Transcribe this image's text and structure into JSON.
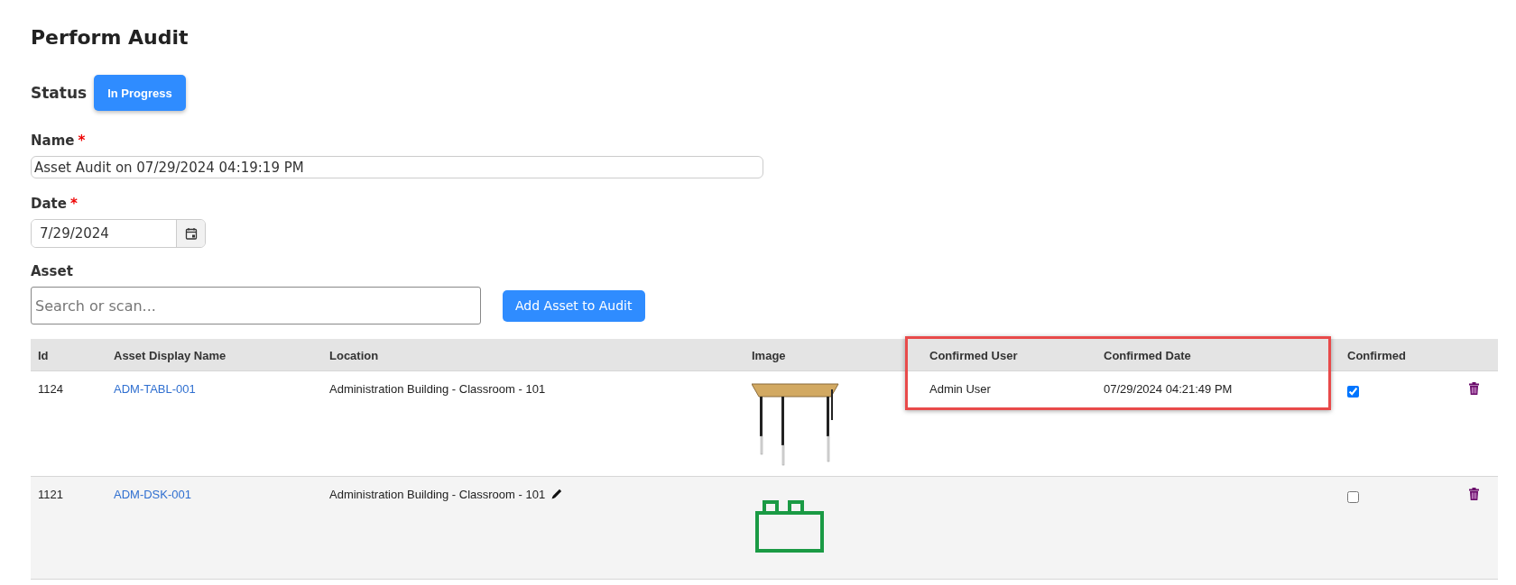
{
  "page": {
    "title": "Perform Audit"
  },
  "status": {
    "label": "Status",
    "value": "In Progress"
  },
  "fields": [
    {
      "label": "Name",
      "required_mark": "*",
      "value": "Asset Audit on 07/29/2024 04:19:19 PM",
      "kind": "text"
    },
    {
      "label": "Date",
      "required_mark": "*",
      "value": "7/29/2024",
      "kind": "date"
    }
  ],
  "asset": {
    "label": "Asset",
    "placeholder": "Search or scan...",
    "button": "Add Asset to Audit"
  },
  "table": {
    "columns": [
      {
        "label": "Id",
        "highlighted": false
      },
      {
        "label": "Asset Display Name",
        "highlighted": false
      },
      {
        "label": "Location",
        "highlighted": false
      },
      {
        "label": "Image",
        "highlighted": false
      },
      {
        "label": "Confirmed User",
        "highlighted": true
      },
      {
        "label": "Confirmed Date",
        "highlighted": true
      },
      {
        "label": "Confirmed",
        "highlighted": false
      }
    ],
    "rows": [
      {
        "id": "1124",
        "name": "ADM-TABL-001",
        "location": "Administration Building - Classroom - 101",
        "editable": false,
        "kind": "photo",
        "confirmed_user": "Admin User",
        "confirmed_date": "07/29/2024 04:21:49 PM",
        "confirmed": true
      },
      {
        "id": "1121",
        "name": "ADM-DSK-001",
        "location": "Administration Building - Classroom - 101",
        "editable": true,
        "kind": "placeholder",
        "confirmed": false
      }
    ]
  }
}
